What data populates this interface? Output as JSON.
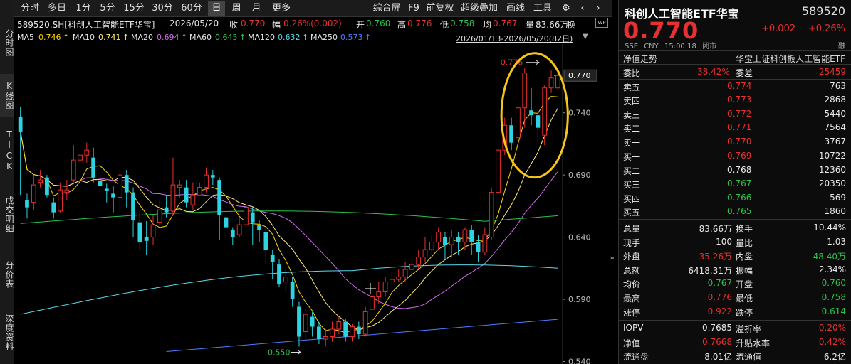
{
  "left_nav": [
    {
      "label": "分时图"
    },
    {
      "label": "K线图",
      "active": true
    },
    {
      "label": "TICK"
    },
    {
      "label": "成交明细"
    },
    {
      "label": "分价表"
    },
    {
      "label": "深度资料"
    }
  ],
  "toolbar": {
    "periods": [
      "分时",
      "多日",
      "1分",
      "5分",
      "15分",
      "30分",
      "60分",
      "日",
      "周",
      "月",
      "更多"
    ],
    "selected_period": "日",
    "right": [
      "综合屏",
      "F9",
      "前复权",
      "超级叠加",
      "画线",
      "工具"
    ],
    "icons": [
      "gear-icon",
      "chevron-left-icon",
      "chevron-right-icon"
    ]
  },
  "info": {
    "security": "589520.SH[科创人工智能ETF华宝]",
    "date": "2026/05/20",
    "close_label": "收",
    "close": "0.770",
    "amp_label": "幅",
    "amp": "0.26%(0.002)",
    "open_label": "开",
    "open": "0.760",
    "high_label": "高",
    "high": "0.776",
    "low_label": "低",
    "low": "0.758",
    "avg_label": "均",
    "avg": "0.767",
    "vol_label": "量",
    "vol": "83.66万",
    "turn_label": "换"
  },
  "ma": [
    {
      "name": "MA5",
      "value": "0.746",
      "arrow": "↑",
      "color": "#ffd700"
    },
    {
      "name": "MA10",
      "value": "0.741",
      "arrow": "↑",
      "color": "#ffeb7a"
    },
    {
      "name": "MA20",
      "value": "0.694",
      "arrow": "↑",
      "color": "#d46cf0"
    },
    {
      "name": "MA60",
      "value": "0.645",
      "arrow": "↑",
      "color": "#2bc24d"
    },
    {
      "name": "MA120",
      "value": "0.632",
      "arrow": "↑",
      "color": "#5ad8e8"
    },
    {
      "name": "MA250",
      "value": "0.573",
      "arrow": "↑",
      "color": "#4e7dff"
    }
  ],
  "date_range": "2026/01/13-2026/05/20(82日)",
  "wp_label": "WP",
  "chart_data": {
    "type": "candlestick",
    "y_ticks": [
      "0.740",
      "0.690",
      "0.640",
      "0.590",
      "0.540"
    ],
    "current_price_tag": "0.770",
    "high_annotation": "0.776",
    "low_annotation": "0.550",
    "ylim": [
      0.538,
      0.785
    ],
    "candles": [
      [
        0.737,
        0.725,
        0.745,
        0.674
      ],
      [
        0.67,
        0.664,
        0.675,
        0.655
      ],
      [
        0.668,
        0.682,
        0.69,
        0.662
      ],
      [
        0.684,
        0.686,
        0.694,
        0.68
      ],
      [
        0.688,
        0.674,
        0.69,
        0.672
      ],
      [
        0.668,
        0.66,
        0.672,
        0.655
      ],
      [
        0.661,
        0.678,
        0.684,
        0.66
      ],
      [
        0.676,
        0.678,
        0.686,
        0.67
      ],
      [
        0.686,
        0.702,
        0.714,
        0.684
      ],
      [
        0.702,
        0.706,
        0.714,
        0.7
      ],
      [
        0.706,
        0.71,
        0.716,
        0.7
      ],
      [
        0.704,
        0.688,
        0.712,
        0.684
      ],
      [
        0.685,
        0.681,
        0.69,
        0.676
      ],
      [
        0.679,
        0.677,
        0.683,
        0.668
      ],
      [
        0.675,
        0.672,
        0.681,
        0.66
      ],
      [
        0.672,
        0.69,
        0.694,
        0.66
      ],
      [
        0.69,
        0.676,
        0.694,
        0.664
      ],
      [
        0.676,
        0.654,
        0.68,
        0.64
      ],
      [
        0.652,
        0.636,
        0.66,
        0.63
      ],
      [
        0.64,
        0.637,
        0.653,
        0.626
      ],
      [
        0.64,
        0.65,
        0.658,
        0.634
      ],
      [
        0.652,
        0.662,
        0.67,
        0.65
      ],
      [
        0.664,
        0.66,
        0.674,
        0.656
      ],
      [
        0.661,
        0.682,
        0.704,
        0.658
      ],
      [
        0.68,
        0.682,
        0.686,
        0.672
      ],
      [
        0.68,
        0.668,
        0.686,
        0.664
      ],
      [
        0.666,
        0.674,
        0.684,
        0.662
      ],
      [
        0.674,
        0.68,
        0.684,
        0.674
      ],
      [
        0.68,
        0.69,
        0.696,
        0.676
      ],
      [
        0.69,
        0.688,
        0.694,
        0.682
      ],
      [
        0.686,
        0.658,
        0.688,
        0.638
      ],
      [
        0.656,
        0.648,
        0.66,
        0.64
      ],
      [
        0.646,
        0.64,
        0.648,
        0.634
      ],
      [
        0.642,
        0.65,
        0.656,
        0.64
      ],
      [
        0.65,
        0.664,
        0.67,
        0.648
      ],
      [
        0.66,
        0.652,
        0.664,
        0.634
      ],
      [
        0.65,
        0.646,
        0.654,
        0.636
      ],
      [
        0.644,
        0.63,
        0.648,
        0.618
      ],
      [
        0.626,
        0.62,
        0.63,
        0.606
      ],
      [
        0.618,
        0.602,
        0.622,
        0.6
      ],
      [
        0.604,
        0.608,
        0.614,
        0.596
      ],
      [
        0.604,
        0.59,
        0.608,
        0.584
      ],
      [
        0.584,
        0.56,
        0.588,
        0.552
      ],
      [
        0.564,
        0.578,
        0.582,
        0.558
      ],
      [
        0.576,
        0.568,
        0.58,
        0.56
      ],
      [
        0.568,
        0.558,
        0.572,
        0.554
      ],
      [
        0.558,
        0.56,
        0.566,
        0.552
      ],
      [
        0.56,
        0.566,
        0.572,
        0.556
      ],
      [
        0.566,
        0.572,
        0.576,
        0.562
      ],
      [
        0.572,
        0.56,
        0.574,
        0.556
      ],
      [
        0.56,
        0.568,
        0.57,
        0.556
      ],
      [
        0.568,
        0.562,
        0.572,
        0.558
      ],
      [
        0.562,
        0.58,
        0.584,
        0.56
      ],
      [
        0.582,
        0.592,
        0.598,
        0.578
      ],
      [
        0.592,
        0.596,
        0.604,
        0.586
      ],
      [
        0.596,
        0.604,
        0.608,
        0.592
      ],
      [
        0.604,
        0.606,
        0.612,
        0.598
      ],
      [
        0.606,
        0.608,
        0.614,
        0.604
      ],
      [
        0.608,
        0.614,
        0.62,
        0.604
      ],
      [
        0.614,
        0.618,
        0.622,
        0.61
      ],
      [
        0.618,
        0.624,
        0.63,
        0.614
      ],
      [
        0.624,
        0.63,
        0.64,
        0.62
      ],
      [
        0.63,
        0.636,
        0.642,
        0.626
      ],
      [
        0.636,
        0.644,
        0.648,
        0.63
      ],
      [
        0.64,
        0.634,
        0.644,
        0.622
      ],
      [
        0.634,
        0.64,
        0.646,
        0.624
      ],
      [
        0.64,
        0.636,
        0.644,
        0.626
      ],
      [
        0.636,
        0.646,
        0.648,
        0.63
      ],
      [
        0.646,
        0.636,
        0.65,
        0.626
      ],
      [
        0.636,
        0.628,
        0.642,
        0.62
      ],
      [
        0.628,
        0.642,
        0.648,
        0.626
      ],
      [
        0.64,
        0.676,
        0.68,
        0.638
      ],
      [
        0.676,
        0.71,
        0.716,
        0.672
      ],
      [
        0.71,
        0.73,
        0.736,
        0.706
      ],
      [
        0.73,
        0.716,
        0.736,
        0.71
      ],
      [
        0.72,
        0.744,
        0.75,
        0.718
      ],
      [
        0.744,
        0.772,
        0.776,
        0.728
      ],
      [
        0.742,
        0.738,
        0.76,
        0.73
      ],
      [
        0.738,
        0.728,
        0.744,
        0.716
      ],
      [
        0.722,
        0.76,
        0.762,
        0.714
      ],
      [
        0.76,
        0.768,
        0.774,
        0.756
      ],
      [
        0.76,
        0.77,
        0.776,
        0.758
      ]
    ]
  },
  "panel": {
    "title": "科创人工智能ETF华宝",
    "code": "589520",
    "price": "0.770",
    "change": "+0.002",
    "change_pct": "+0.26%",
    "sub": [
      "SSE",
      "CNY",
      "15:00:18",
      "闭市"
    ],
    "rong": "融",
    "nav_trend": "净值走势",
    "index_name": "华宝上证科创板人工智能ETF",
    "weibi_label": "委比",
    "weibi": "38.42%",
    "weicha_label": "委差",
    "weicha": "25459",
    "asks": [
      {
        "label": "卖五",
        "price": "0.774",
        "vol": "763"
      },
      {
        "label": "卖四",
        "price": "0.773",
        "vol": "2868"
      },
      {
        "label": "卖三",
        "price": "0.772",
        "vol": "5440"
      },
      {
        "label": "卖二",
        "price": "0.771",
        "vol": "7564"
      },
      {
        "label": "卖一",
        "price": "0.770",
        "vol": "3767"
      }
    ],
    "bids": [
      {
        "label": "买一",
        "price": "0.769",
        "vol": "10722",
        "color": "red"
      },
      {
        "label": "买二",
        "price": "0.768",
        "vol": "12360",
        "color": "white"
      },
      {
        "label": "买三",
        "price": "0.767",
        "vol": "20350",
        "color": "green"
      },
      {
        "label": "买四",
        "price": "0.766",
        "vol": "569",
        "color": "green"
      },
      {
        "label": "买五",
        "price": "0.765",
        "vol": "1860",
        "color": "green"
      }
    ],
    "stats": [
      {
        "l1": "总量",
        "v1": "83.66万",
        "c1": "white",
        "l2": "换手",
        "v2": "10.44%",
        "c2": "white"
      },
      {
        "l1": "现手",
        "v1": "100",
        "c1": "white",
        "l2": "量比",
        "v2": "1.03",
        "c2": "white"
      },
      {
        "l1": "外盘",
        "v1": "35.26万",
        "c1": "red",
        "l2": "内盘",
        "v2": "48.40万",
        "c2": "green"
      },
      {
        "l1": "总额",
        "v1": "6418.31万",
        "c1": "white",
        "l2": "振幅",
        "v2": "2.34%",
        "c2": "white"
      },
      {
        "l1": "均价",
        "v1": "0.767",
        "c1": "green",
        "l2": "开盘",
        "v2": "0.760",
        "c2": "green"
      },
      {
        "l1": "最高",
        "v1": "0.776",
        "c1": "red",
        "l2": "最低",
        "v2": "0.758",
        "c2": "green"
      },
      {
        "l1": "涨停",
        "v1": "0.922",
        "c1": "red",
        "l2": "跌停",
        "v2": "0.614",
        "c2": "green"
      }
    ],
    "extra": [
      {
        "l1": "IOPV",
        "v1": "0.7685",
        "c1": "white",
        "l2": "溢折率",
        "v2": "0.20%",
        "c2": "red"
      },
      {
        "l1": "净值",
        "v1": "0.7668",
        "c1": "red",
        "l2": "升贴水率",
        "v2": "0.42%",
        "c2": "red"
      },
      {
        "l1": "流通盘",
        "v1": "8.01亿",
        "c1": "white",
        "l2": "流通值",
        "v2": "6.2亿",
        "c2": "white"
      }
    ]
  },
  "colors": {
    "up": "#e93030",
    "down": "#2dd3e0",
    "highlight": "#f5c518"
  }
}
